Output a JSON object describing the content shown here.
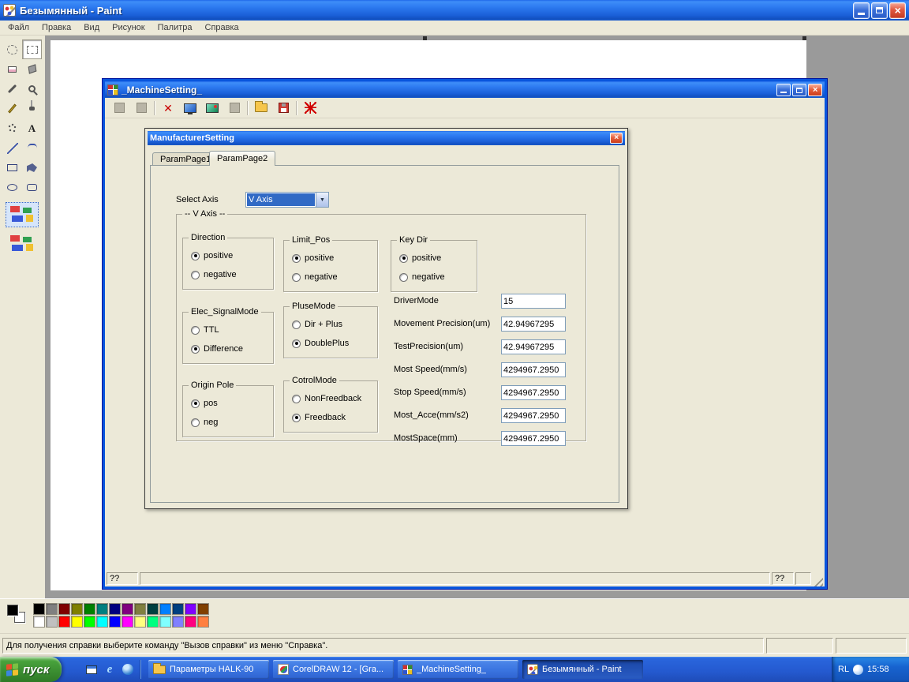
{
  "paint": {
    "title": "Безымянный - Paint",
    "menu": [
      "Файл",
      "Правка",
      "Вид",
      "Рисунок",
      "Палитра",
      "Справка"
    ],
    "status_text": "Для получения справки выберите команду \"Вызов справки\" из меню \"Справка\".",
    "fg_color": "#000000",
    "bg_color": "#ffffff",
    "palette": [
      [
        "#000000",
        "#808080",
        "#800000",
        "#808000",
        "#008000",
        "#008080",
        "#000080",
        "#800080",
        "#808040",
        "#004040",
        "#0080ff",
        "#004080",
        "#8000ff",
        "#804000"
      ],
      [
        "#ffffff",
        "#c0c0c0",
        "#ff0000",
        "#ffff00",
        "#00ff00",
        "#00ffff",
        "#0000ff",
        "#ff00ff",
        "#ffff80",
        "#00ff80",
        "#80ffff",
        "#8080ff",
        "#ff0080",
        "#ff8040"
      ]
    ]
  },
  "machine": {
    "title": "_MachineSetting_",
    "status_cells": [
      "??",
      "??"
    ]
  },
  "dialog": {
    "title": "ManufacturerSetting",
    "tabs": [
      "ParamPage1",
      "ParamPage2"
    ],
    "select_axis_label": "Select Axis",
    "select_axis_value": "V Axis",
    "group_title": "-- V Axis --",
    "radio_groups": [
      {
        "title": "Direction",
        "options": [
          "positive",
          "negative"
        ],
        "selected": 0
      },
      {
        "title": "Limit_Pos",
        "options": [
          "positive",
          "negative"
        ],
        "selected": 0
      },
      {
        "title": "Key Dir",
        "options": [
          "positive",
          "negative"
        ],
        "selected": 0
      },
      {
        "title": "Elec_SignalMode",
        "options": [
          "TTL",
          "Difference"
        ],
        "selected": 1
      },
      {
        "title": "PluseMode",
        "options": [
          "Dir + Plus",
          "DoublePlus"
        ],
        "selected": 1
      },
      {
        "title": "Origin Pole",
        "options": [
          "pos",
          "neg"
        ],
        "selected": 0
      },
      {
        "title": "CotrolMode",
        "options": [
          "NonFreedback",
          "Freedback"
        ],
        "selected": 1
      }
    ],
    "fields": [
      {
        "label": "DriverMode",
        "value": "15"
      },
      {
        "label": "Movement Precision(um)",
        "value": "42.94967295"
      },
      {
        "label": "TestPrecision(um)",
        "value": "42.94967295"
      },
      {
        "label": "Most Speed(mm/s)",
        "value": "4294967.2950"
      },
      {
        "label": "Stop Speed(mm/s)",
        "value": "4294967.2950"
      },
      {
        "label": "Most_Acce(mm/s2)",
        "value": "4294967.2950"
      },
      {
        "label": "MostSpace(mm)",
        "value": "4294967.2950"
      }
    ]
  },
  "taskbar": {
    "start_label": "пуск",
    "tasks": [
      {
        "label": "Параметры HALK-90",
        "active": false
      },
      {
        "label": "CorelDRAW 12 - [Gra...",
        "active": false
      },
      {
        "label": "_MachineSetting_",
        "active": false
      },
      {
        "label": "Безымянный - Paint",
        "active": true
      }
    ],
    "tray_label": "RL",
    "time": "15:58"
  }
}
